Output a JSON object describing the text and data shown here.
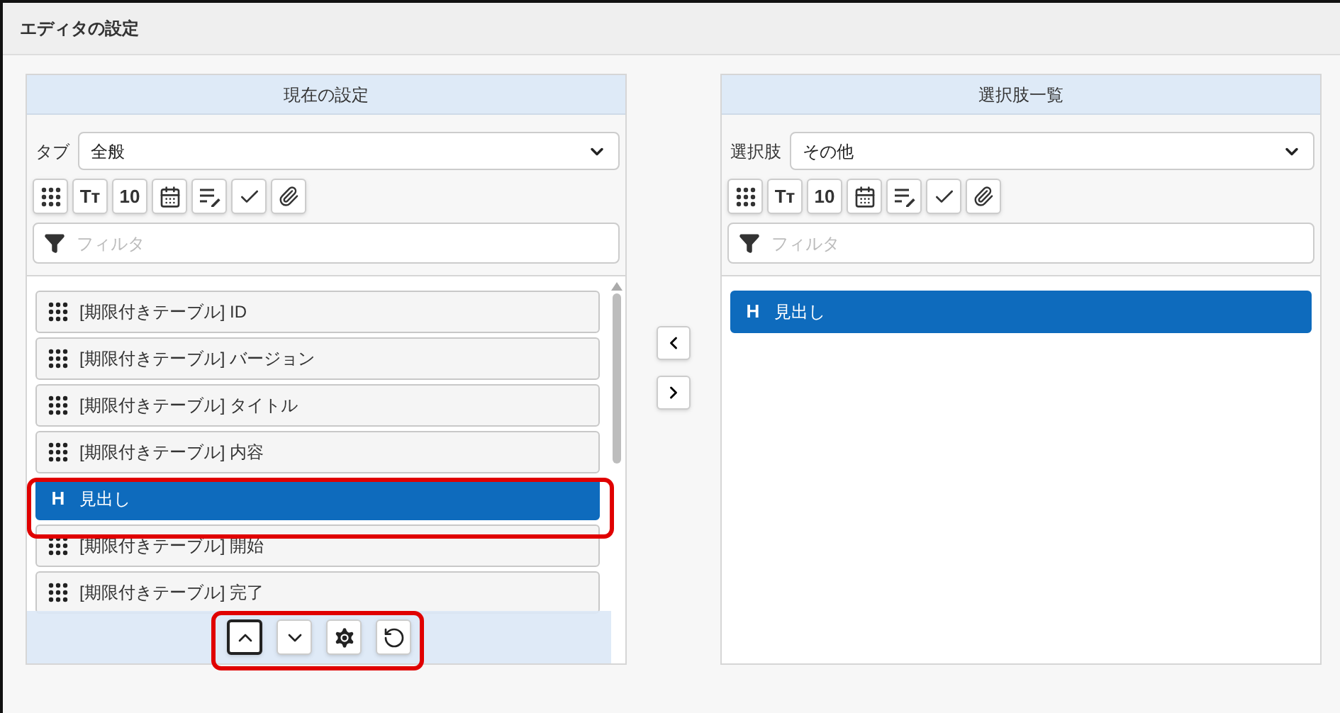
{
  "window": {
    "title": "エディタの設定"
  },
  "left_panel": {
    "title": "現在の設定",
    "select_label": "タブ",
    "select_value": "全般",
    "toolbar": [
      {
        "kind": "grid"
      },
      {
        "kind": "glyph",
        "glyph": "Tт"
      },
      {
        "kind": "glyph",
        "glyph": "10"
      },
      {
        "kind": "calendar"
      },
      {
        "kind": "edit"
      },
      {
        "kind": "check"
      },
      {
        "kind": "clip"
      }
    ],
    "filter": {
      "placeholder": "フィルタ"
    },
    "items": [
      {
        "kind": "field",
        "label": "[期限付きテーブル] ID",
        "selected": false
      },
      {
        "kind": "field",
        "label": "[期限付きテーブル] バージョン",
        "selected": false
      },
      {
        "kind": "field",
        "label": "[期限付きテーブル] タイトル",
        "selected": false
      },
      {
        "kind": "field",
        "label": "[期限付きテーブル] 内容",
        "selected": false
      },
      {
        "kind": "heading",
        "badge": "H",
        "label": "見出し",
        "selected": true
      },
      {
        "kind": "field",
        "label": "[期限付きテーブル] 開始",
        "selected": false
      },
      {
        "kind": "field",
        "label": "[期限付きテーブル] 完了",
        "selected": false
      }
    ],
    "actions": [
      {
        "kind": "up",
        "focused": true
      },
      {
        "kind": "down",
        "focused": false
      },
      {
        "kind": "gear",
        "focused": false
      },
      {
        "kind": "reset",
        "focused": false
      }
    ]
  },
  "move_buttons": [
    {
      "kind": "left"
    },
    {
      "kind": "right"
    }
  ],
  "right_panel": {
    "title": "選択肢一覧",
    "select_label": "選択肢",
    "select_value": "その他",
    "toolbar": [
      {
        "kind": "grid"
      },
      {
        "kind": "glyph",
        "glyph": "Tт"
      },
      {
        "kind": "glyph",
        "glyph": "10"
      },
      {
        "kind": "calendar"
      },
      {
        "kind": "edit"
      },
      {
        "kind": "check"
      },
      {
        "kind": "clip"
      }
    ],
    "filter": {
      "placeholder": "フィルタ"
    },
    "items": [
      {
        "kind": "heading",
        "badge": "H",
        "label": "見出し",
        "selected": true
      }
    ]
  }
}
